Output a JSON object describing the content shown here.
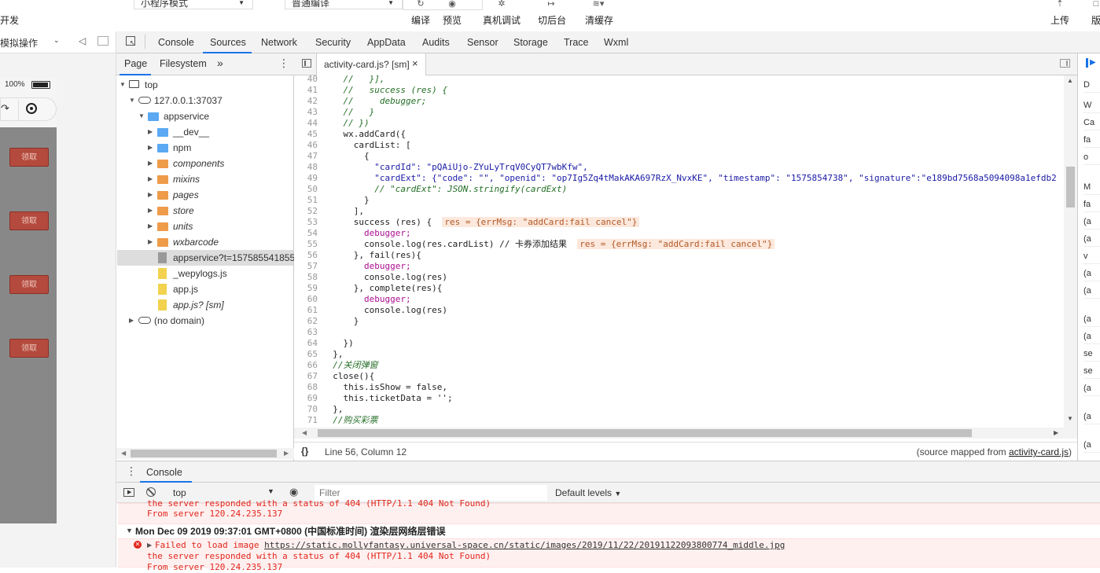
{
  "toolbar": {
    "left_text": "开发",
    "mode_select": "小程序模式",
    "compile_select": "普通编译",
    "buttons": [
      {
        "label": "编译",
        "icon": "refresh-icon"
      },
      {
        "label": "预览",
        "icon": "eye-icon"
      },
      {
        "label": "真机调试",
        "icon": "bug-icon"
      },
      {
        "label": "切后台",
        "icon": "exit-icon"
      },
      {
        "label": "清缓存",
        "icon": "layers-icon"
      },
      {
        "label": "上传",
        "icon": "upload-icon"
      },
      {
        "label": "版",
        "icon": "version-icon"
      }
    ]
  },
  "simulator": {
    "op_select": "模拟操作",
    "battery": "100%",
    "claim_buttons": [
      "领取",
      "领取",
      "领取",
      "领取"
    ]
  },
  "devtools_tabs": [
    "Console",
    "Sources",
    "Network",
    "Security",
    "AppData",
    "Audits",
    "Sensor",
    "Storage",
    "Trace",
    "Wxml"
  ],
  "active_devtools_tab": "Sources",
  "navigator": {
    "tabs": [
      "Page",
      "Filesystem"
    ],
    "more": "»",
    "tree": [
      {
        "label": "top",
        "kind": "frame",
        "level": 0,
        "open": true
      },
      {
        "label": "127.0.0.1:37037",
        "kind": "cloud",
        "level": 1,
        "open": true
      },
      {
        "label": "appservice",
        "kind": "folder-blue",
        "level": 2,
        "open": true
      },
      {
        "label": "__dev__",
        "kind": "folder-blue",
        "level": 3,
        "open": false
      },
      {
        "label": "npm",
        "kind": "folder-blue",
        "level": 3,
        "open": false
      },
      {
        "label": "components",
        "kind": "folder-orange",
        "level": 3,
        "open": false,
        "italic": true
      },
      {
        "label": "mixins",
        "kind": "folder-orange",
        "level": 3,
        "open": false,
        "italic": true
      },
      {
        "label": "pages",
        "kind": "folder-orange",
        "level": 3,
        "open": false,
        "italic": true
      },
      {
        "label": "store",
        "kind": "folder-orange",
        "level": 3,
        "open": false,
        "italic": true
      },
      {
        "label": "units",
        "kind": "folder-orange",
        "level": 3,
        "open": false,
        "italic": true
      },
      {
        "label": "wxbarcode",
        "kind": "folder-orange",
        "level": 3,
        "open": false,
        "italic": true
      },
      {
        "label": "appservice?t=157585541855",
        "kind": "file-gray",
        "level": 3,
        "selected": true
      },
      {
        "label": "_wepylogs.js",
        "kind": "file-yellow",
        "level": 3
      },
      {
        "label": "app.js",
        "kind": "file-yellow",
        "level": 3
      },
      {
        "label": "app.js? [sm]",
        "kind": "file-yellow",
        "level": 3,
        "italic": true
      },
      {
        "label": "(no domain)",
        "kind": "cloud",
        "level": 1,
        "open": false
      }
    ]
  },
  "editor": {
    "tab_title": "activity-card.js? [sm]",
    "close": "×",
    "lines": [
      {
        "n": "40",
        "t": "    //   }],",
        "c": "c-com"
      },
      {
        "n": "41",
        "t": "    //   success (res) {",
        "c": "c-com"
      },
      {
        "n": "42",
        "t": "    //     debugger;",
        "c": "c-com"
      },
      {
        "n": "43",
        "t": "    //   }",
        "c": "c-com"
      },
      {
        "n": "44",
        "t": "    // })",
        "c": "c-com"
      },
      {
        "n": "45",
        "t": "    wx.addCard({",
        "c": "c-ident"
      },
      {
        "n": "46",
        "t": "      cardList: [",
        "c": "c-ident"
      },
      {
        "n": "47",
        "t": "        {",
        "c": "c-ident"
      },
      {
        "n": "48",
        "t": "          \"cardId\": \"pQAiUjo-ZYuLyTrqV0CyQT7wbKfw\",",
        "c": "c-str"
      },
      {
        "n": "49",
        "t": "          \"cardExt\": {\"code\": \"\", \"openid\": \"op7Ig5Zq4tMakAKA697RzX_NvxKE\", \"timestamp\": \"1575854738\", \"signature\":\"e189bd7568a5094098a1efdb2",
        "c": "c-str"
      },
      {
        "n": "50",
        "t": "          // \"cardExt\": JSON.stringify(cardExt)",
        "c": "c-com"
      },
      {
        "n": "51",
        "t": "        }",
        "c": "c-ident"
      },
      {
        "n": "52",
        "t": "      ],",
        "c": "c-ident"
      },
      {
        "n": "53",
        "t": "      success (res) {",
        "c": "c-ident",
        "inline": "res = {errMsg: \"addCard:fail cancel\"}"
      },
      {
        "n": "54",
        "t": "        debugger;",
        "c": "c-kw"
      },
      {
        "n": "55",
        "t": "        console.log(res.cardList) // 卡券添加结果",
        "c": "c-ident",
        "inline": "res = {errMsg: \"addCard:fail cancel\"}"
      },
      {
        "n": "56",
        "t": "      }, fail(res){",
        "c": "c-ident"
      },
      {
        "n": "57",
        "t": "        debugger;",
        "c": "c-kw"
      },
      {
        "n": "58",
        "t": "        console.log(res)",
        "c": "c-ident"
      },
      {
        "n": "59",
        "t": "      }, complete(res){",
        "c": "c-ident"
      },
      {
        "n": "60",
        "t": "        debugger;",
        "c": "c-kw"
      },
      {
        "n": "61",
        "t": "        console.log(res)",
        "c": "c-ident"
      },
      {
        "n": "62",
        "t": "      }",
        "c": "c-ident"
      },
      {
        "n": "63",
        "t": "",
        "c": "c-ident"
      },
      {
        "n": "64",
        "t": "    })",
        "c": "c-ident"
      },
      {
        "n": "65",
        "t": "  },",
        "c": "c-ident"
      },
      {
        "n": "66",
        "t": "  //关闭弹窗",
        "c": "c-com"
      },
      {
        "n": "67",
        "t": "  close(){",
        "c": "c-ident"
      },
      {
        "n": "68",
        "t": "    this.isShow = false,",
        "c": "c-ident"
      },
      {
        "n": "69",
        "t": "    this.ticketData = '';",
        "c": "c-ident"
      },
      {
        "n": "70",
        "t": "  },",
        "c": "c-ident"
      },
      {
        "n": "71",
        "t": "  //购买彩票",
        "c": "c-com"
      },
      {
        "n": "72",
        "t": "  ",
        "c": "c-ident"
      }
    ],
    "status_left": "{}",
    "status_pos": "Line 56, Column 12",
    "status_right_prefix": "(source mapped from ",
    "status_right_link": "activity-card.js",
    "status_right_suffix": ")"
  },
  "right_panel": {
    "rows": [
      "D",
      "W",
      "Ca",
      "fa",
      "o",
      "M",
      "fa",
      "(a",
      "(a",
      "v",
      "(a",
      "(a",
      "(a",
      "(a",
      "se",
      "se",
      "(a",
      "(a",
      "(a"
    ]
  },
  "console": {
    "tab": "Console",
    "context": "top",
    "filter_placeholder": "Filter",
    "levels": "Default levels",
    "lines": [
      {
        "text": "the server responded with a status of 404 (HTTP/1.1 404 Not Found)",
        "type": "err"
      },
      {
        "text": "From server 120.24.235.137",
        "type": "err"
      },
      {
        "text": "Mon Dec 09 2019 09:37:01 GMT+0800 (中国标准时间) 渲染层网络层错误",
        "type": "group"
      },
      {
        "text": "Failed to load image ",
        "link": "https://static.mollyfantasy.universal-space.cn/static/images/2019/11/22/20191122093800774_middle.jpg",
        "type": "err-head"
      },
      {
        "text": "the server responded with a status of 404 (HTTP/1.1 404 Not Found)",
        "type": "err"
      },
      {
        "text": "From server 120.24.235.137",
        "type": "err"
      }
    ]
  },
  "colors": {
    "accent": "#1a73e8",
    "error": "#e0261b",
    "claim_button": "#b34a3d"
  }
}
